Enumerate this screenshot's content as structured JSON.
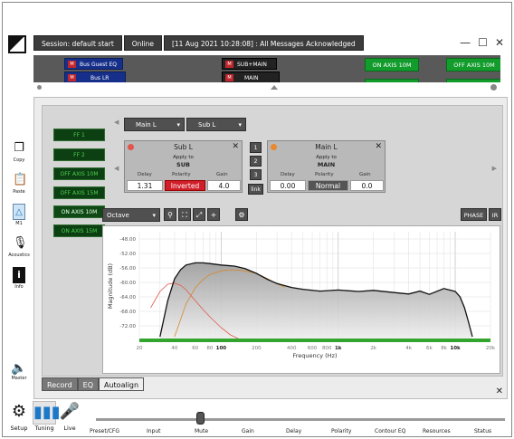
{
  "session": {
    "label": "Session: default start",
    "status": "Online",
    "messages": "[11 Aug 2021 10:28:08] : All Messages Acknowledged"
  },
  "strip": {
    "chips_blue": [
      {
        "mute": "M",
        "label": "Bus Guest EQ"
      },
      {
        "mute": "M",
        "label": "Bus LR"
      }
    ],
    "chips_dark": [
      {
        "mute": "M",
        "label": "SUB+MAIN"
      },
      {
        "mute": "M",
        "label": "MAIN"
      }
    ],
    "chips_green": [
      "ON AXIS 10M",
      "OFF AXIS 10M"
    ]
  },
  "leftbar": [
    {
      "label": "Copy",
      "icon": "copy-icon"
    },
    {
      "label": "Paste",
      "icon": "paste-icon"
    },
    {
      "label": "M1",
      "icon": "m1-icon"
    },
    {
      "label": "Acoustics",
      "icon": "acoustics-icon"
    },
    {
      "label": "Info",
      "icon": "info-icon"
    }
  ],
  "master_label": "Master",
  "sidechannels": [
    "FF 1",
    "FF 2",
    "OFF AXIS 10M",
    "OFF AXIS 15M",
    "ON AXIS 10M",
    "ON AXIS 15M"
  ],
  "dropdowns": {
    "left": "Main L",
    "right": "Sub L"
  },
  "cards": {
    "sub": {
      "name": "Sub L",
      "apply_to": "Apply to",
      "target": "SUB",
      "labels": [
        "Delay",
        "Polarity",
        "Gain"
      ],
      "delay": "1.31",
      "polarity": "Inverted",
      "gain": "4.0",
      "dot_color": "#e2544d"
    },
    "main": {
      "name": "Main L",
      "apply_to": "Apply to",
      "target": "MAIN",
      "labels": [
        "Delay",
        "Polarity",
        "Gain"
      ],
      "delay": "0.00",
      "polarity": "Normal",
      "gain": "0.0",
      "dot_color": "#e88830"
    }
  },
  "numbtns": [
    "1",
    "2",
    "3",
    "link"
  ],
  "toolbar": {
    "scale": "Octave",
    "phase": "PHASE",
    "ir": "IR"
  },
  "tabs": [
    "Record",
    "EQ",
    "Autoalign"
  ],
  "selected_tab": "Autoalign",
  "bottom_icons": [
    {
      "label": "Setup",
      "icon": "gears-icon"
    },
    {
      "label": "Tuning",
      "icon": "bar-chart-icon"
    },
    {
      "label": "Live",
      "icon": "mic-icon"
    }
  ],
  "rail_labels": [
    "Preset/CFG",
    "Input",
    "Mute",
    "Gain",
    "Delay",
    "Polarity",
    "Contour EQ",
    "Resources",
    "Status"
  ],
  "chart_data": {
    "type": "line",
    "xlabel": "Frequency (Hz)",
    "ylabel": "Magnitude (dB)",
    "xscale": "log",
    "xlim": [
      20,
      20000
    ],
    "ylim": [
      -76,
      -46
    ],
    "yticks": [
      -48,
      -52,
      -56,
      -60,
      -64,
      -68,
      -72
    ],
    "ytick_labels": [
      "-48.00",
      "-52.00",
      "-56.00",
      "-60.00",
      "-64.00",
      "-68.00",
      "-72.00"
    ],
    "xtick_labels": [
      {
        "v": 20,
        "t": "20"
      },
      {
        "v": 40,
        "t": "40"
      },
      {
        "v": 60,
        "t": "60"
      },
      {
        "v": 80,
        "t": "80"
      },
      {
        "v": 100,
        "t": "100"
      },
      {
        "v": 200,
        "t": "200"
      },
      {
        "v": 400,
        "t": "400"
      },
      {
        "v": 600,
        "t": "600"
      },
      {
        "v": 800,
        "t": "800"
      },
      {
        "v": 1000,
        "t": "1k"
      },
      {
        "v": 2000,
        "t": "2k"
      },
      {
        "v": 4000,
        "t": "4k"
      },
      {
        "v": 6000,
        "t": "6k"
      },
      {
        "v": 8000,
        "t": "8k"
      },
      {
        "v": 10000,
        "t": "10k"
      },
      {
        "v": 20000,
        "t": "20k"
      }
    ],
    "series": [
      {
        "color": "#111111",
        "fill": true,
        "x": [
          30,
          35,
          40,
          45,
          50,
          60,
          70,
          80,
          100,
          130,
          160,
          200,
          250,
          300,
          400,
          500,
          700,
          1000,
          1500,
          2000,
          3000,
          4000,
          5000,
          6000,
          8000,
          10000,
          11000,
          12000,
          13000,
          14000
        ],
        "y": [
          -75,
          -65,
          -59,
          -56.5,
          -55.2,
          -54.6,
          -54.6,
          -54.8,
          -55.2,
          -55.5,
          -56.2,
          -57.5,
          -59.2,
          -60.3,
          -61.4,
          -61.9,
          -62.4,
          -62.1,
          -62.5,
          -62.2,
          -62.8,
          -63.2,
          -62.4,
          -63.3,
          -61.7,
          -62.5,
          -64,
          -67,
          -71,
          -75
        ]
      },
      {
        "color": "#d8882f",
        "x": [
          40,
          50,
          60,
          70,
          80,
          100,
          120,
          150,
          200,
          250,
          300,
          350
        ],
        "y": [
          -75,
          -66,
          -61.5,
          -59.2,
          -57.8,
          -56.8,
          -56.5,
          -56.7,
          -57.5,
          -59,
          -60.4,
          -61.3
        ]
      },
      {
        "color": "#e05a4a",
        "x": [
          25,
          30,
          35,
          40,
          45,
          50,
          60,
          70,
          80,
          100,
          120,
          150
        ],
        "y": [
          -67,
          -62.5,
          -60.5,
          -60.2,
          -60.8,
          -62,
          -65,
          -67.5,
          -69.5,
          -72.5,
          -74.5,
          -77
        ]
      }
    ]
  }
}
